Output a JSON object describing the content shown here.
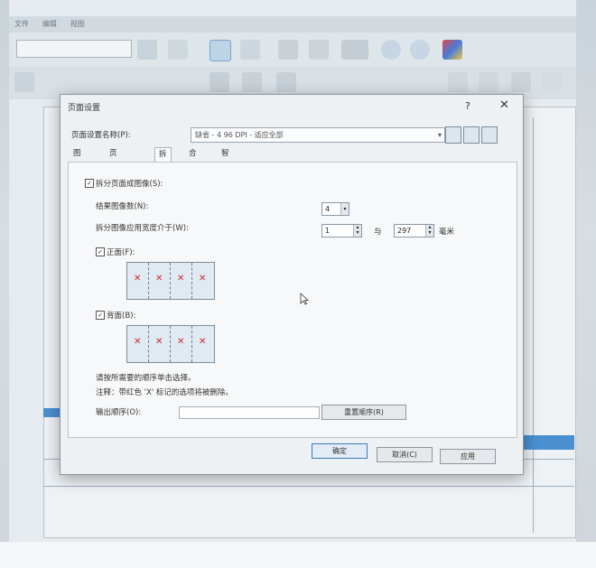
{
  "background_app": {
    "menu": [
      "文件",
      "编辑",
      "视图"
    ]
  },
  "dialog": {
    "title": "页面设置",
    "help_label": "?",
    "close_label": "✕",
    "profile_label": "页面设置名称(P):",
    "profile_value": "缺省 - 4 96 DPI - 适应全部",
    "tabs": [
      "图像",
      "页面图像",
      "拆分",
      "合并",
      "智能 QC"
    ],
    "active_tab": "拆分",
    "split": {
      "split_pages_label": "拆分页面成图像(S):",
      "split_pages_checked": true,
      "result_count_label": "结果图像数(N):",
      "result_count_value": "4",
      "width_condition_label": "拆分图像应用宽度介于(W):",
      "min_width": "1",
      "and_label": "与",
      "max_width": "297",
      "unit_label": "毫米",
      "front_label": "正面(F):",
      "front_checked": true,
      "back_label": "背面(B):",
      "back_checked": true,
      "note_line1": "请按所需要的顺序单击选择。",
      "note_line2": "注释：带红色 'X' 标记的选项将被删除。",
      "output_order_label": "输出顺序(O):",
      "output_order_value": "",
      "reset_order_button": "重置顺序(R)"
    },
    "buttons": {
      "ok": "确定",
      "cancel": "取消(C)",
      "apply": "应用"
    }
  },
  "colors": {
    "accent": "#3a78c2",
    "mark_red": "#cc2b2b",
    "page_fill": "#dfeaf2"
  }
}
